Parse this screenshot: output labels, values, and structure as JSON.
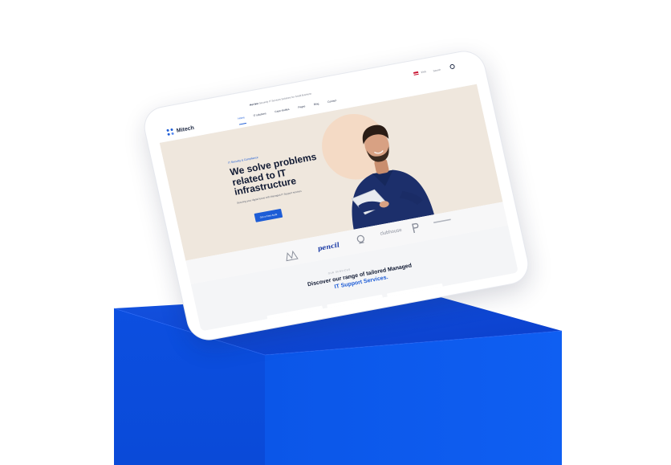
{
  "topbar": {
    "notice_bold": "Hot line",
    "notice_text": "Securely IT Services Solutions for Small Business",
    "language": "ENG",
    "search_placeholder": "Search"
  },
  "brand": {
    "name": "Mitech"
  },
  "nav": {
    "items": [
      {
        "label": "Home",
        "active": true
      },
      {
        "label": "IT solutions"
      },
      {
        "label": "Case studies"
      },
      {
        "label": "Pages"
      },
      {
        "label": "Blog"
      },
      {
        "label": "Contact"
      }
    ]
  },
  "hero": {
    "eyebrow": "IT Security & Compliance",
    "headline": "We solve problems related to IT infrastructure",
    "subtext": "Securing your digital future with Managed IT Support services",
    "cta_label": "Get a Free Audit"
  },
  "brands": [
    "pencil",
    "clubhouse"
  ],
  "services": {
    "label": "Our Services",
    "title_main": "Discover our range of tailored Managed",
    "title_highlight": "IT Support Services."
  },
  "colors": {
    "accent": "#1e5dd6",
    "cube_top": "#0c45d8",
    "cube_front": "#0b47d1",
    "cube_side": "#0a3fc2"
  }
}
